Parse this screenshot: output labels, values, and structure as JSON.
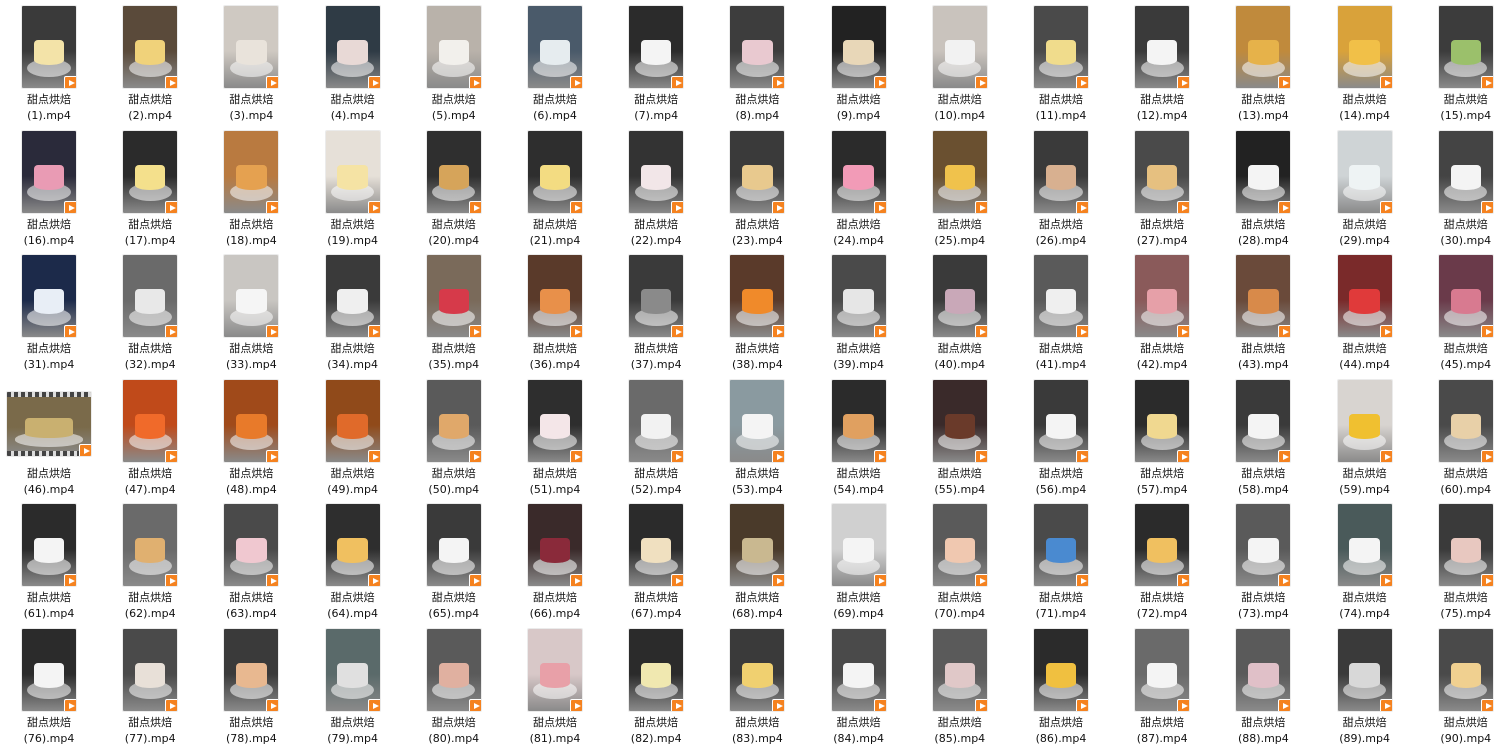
{
  "window": {
    "title": ""
  },
  "files": [
    {
      "prefix": "甜点烘焙",
      "suffix": "(1).mp4",
      "bg": "#3a3a3a",
      "accent": "#f3e3a8"
    },
    {
      "prefix": "甜点烘焙",
      "suffix": "(2).mp4",
      "bg": "#5a4a3a",
      "accent": "#f0d27a"
    },
    {
      "prefix": "甜点烘焙",
      "suffix": "(3).mp4",
      "bg": "#cfc9c2",
      "accent": "#e9e3db"
    },
    {
      "prefix": "甜点烘焙",
      "suffix": "(4).mp4",
      "bg": "#2f3b45",
      "accent": "#e8d9d6"
    },
    {
      "prefix": "甜点烘焙",
      "suffix": "(5).mp4",
      "bg": "#b9b2aa",
      "accent": "#f2f0ec"
    },
    {
      "prefix": "甜点烘焙",
      "suffix": "(6).mp4",
      "bg": "#4a5a6a",
      "accent": "#e6ecef"
    },
    {
      "prefix": "甜点烘焙",
      "suffix": "(7).mp4",
      "bg": "#2b2b2b",
      "accent": "#f4f4f4"
    },
    {
      "prefix": "甜点烘焙",
      "suffix": "(8).mp4",
      "bg": "#3d3d3d",
      "accent": "#e9c9d0"
    },
    {
      "prefix": "甜点烘焙",
      "suffix": "(9).mp4",
      "bg": "#222222",
      "accent": "#e8d7b8"
    },
    {
      "prefix": "甜点烘焙",
      "suffix": "(10).mp4",
      "bg": "#c9c3bd",
      "accent": "#f2f2f2"
    },
    {
      "prefix": "甜点烘焙",
      "suffix": "(11).mp4",
      "bg": "#4a4a4a",
      "accent": "#f0dc8c"
    },
    {
      "prefix": "甜点烘焙",
      "suffix": "(12).mp4",
      "bg": "#3a3a3a",
      "accent": "#f4f4f4"
    },
    {
      "prefix": "甜点烘焙",
      "suffix": "(13).mp4",
      "bg": "#c08a3c",
      "accent": "#e6b24a"
    },
    {
      "prefix": "甜点烘焙",
      "suffix": "(14).mp4",
      "bg": "#d9a23a",
      "accent": "#f1c048"
    },
    {
      "prefix": "甜点烘焙",
      "suffix": "(15).mp4",
      "bg": "#3c3c3c",
      "accent": "#9bc06b"
    },
    {
      "prefix": "甜点烘焙",
      "suffix": "(16).mp4",
      "bg": "#2a2a3a",
      "accent": "#e99bb4"
    },
    {
      "prefix": "甜点烘焙",
      "suffix": "(17).mp4",
      "bg": "#2b2b2b",
      "accent": "#f4e08c"
    },
    {
      "prefix": "甜点烘焙",
      "suffix": "(18).mp4",
      "bg": "#b97a40",
      "accent": "#e5a150"
    },
    {
      "prefix": "甜点烘焙",
      "suffix": "(19).mp4",
      "bg": "#e6e0d8",
      "accent": "#f5e3a4"
    },
    {
      "prefix": "甜点烘焙",
      "suffix": "(20).mp4",
      "bg": "#2f2f2f",
      "accent": "#d6a45a"
    },
    {
      "prefix": "甜点烘焙",
      "suffix": "(21).mp4",
      "bg": "#2e2e2e",
      "accent": "#f3dc82"
    },
    {
      "prefix": "甜点烘焙",
      "suffix": "(22).mp4",
      "bg": "#333333",
      "accent": "#f2e6e8"
    },
    {
      "prefix": "甜点烘焙",
      "suffix": "(23).mp4",
      "bg": "#3a3a3a",
      "accent": "#e8c98e"
    },
    {
      "prefix": "甜点烘焙",
      "suffix": "(24).mp4",
      "bg": "#2b2b2b",
      "accent": "#f29bb7"
    },
    {
      "prefix": "甜点烘焙",
      "suffix": "(25).mp4",
      "bg": "#6a5030",
      "accent": "#f0c24c"
    },
    {
      "prefix": "甜点烘焙",
      "suffix": "(26).mp4",
      "bg": "#3a3a3a",
      "accent": "#d8b090"
    },
    {
      "prefix": "甜点烘焙",
      "suffix": "(27).mp4",
      "bg": "#4a4a4a",
      "accent": "#e6c080"
    },
    {
      "prefix": "甜点烘焙",
      "suffix": "(28).mp4",
      "bg": "#222222",
      "accent": "#f4f4f4"
    },
    {
      "prefix": "甜点烘焙",
      "suffix": "(29).mp4",
      "bg": "#cfd4d6",
      "accent": "#eef3f4"
    },
    {
      "prefix": "甜点烘焙",
      "suffix": "(30).mp4",
      "bg": "#444444",
      "accent": "#f4f4f4"
    },
    {
      "prefix": "甜点烘焙",
      "suffix": "(31).mp4",
      "bg": "#1c2a4a",
      "accent": "#e8eef6"
    },
    {
      "prefix": "甜点烘焙",
      "suffix": "(32).mp4",
      "bg": "#6a6a6a",
      "accent": "#e8e8e8"
    },
    {
      "prefix": "甜点烘焙",
      "suffix": "(33).mp4",
      "bg": "#c9c6c2",
      "accent": "#f5f5f5"
    },
    {
      "prefix": "甜点烘焙",
      "suffix": "(34).mp4",
      "bg": "#3a3a3a",
      "accent": "#efefef"
    },
    {
      "prefix": "甜点烘焙",
      "suffix": "(35).mp4",
      "bg": "#7a6a5a",
      "accent": "#d63a4a"
    },
    {
      "prefix": "甜点烘焙",
      "suffix": "(36).mp4",
      "bg": "#5a3a2a",
      "accent": "#e8904a"
    },
    {
      "prefix": "甜点烘焙",
      "suffix": "(37).mp4",
      "bg": "#3a3a3a",
      "accent": "#8a8a8a"
    },
    {
      "prefix": "甜点烘焙",
      "suffix": "(38).mp4",
      "bg": "#5a3a2a",
      "accent": "#f08a2a"
    },
    {
      "prefix": "甜点烘焙",
      "suffix": "(39).mp4",
      "bg": "#4a4a4a",
      "accent": "#e6e6e6"
    },
    {
      "prefix": "甜点烘焙",
      "suffix": "(40).mp4",
      "bg": "#3a3a3a",
      "accent": "#c9a8b8"
    },
    {
      "prefix": "甜点烘焙",
      "suffix": "(41).mp4",
      "bg": "#5a5a5a",
      "accent": "#efefef"
    },
    {
      "prefix": "甜点烘焙",
      "suffix": "(42).mp4",
      "bg": "#8a5a5a",
      "accent": "#e6a0a8"
    },
    {
      "prefix": "甜点烘焙",
      "suffix": "(43).mp4",
      "bg": "#6a4a3a",
      "accent": "#d88a4a"
    },
    {
      "prefix": "甜点烘焙",
      "suffix": "(44).mp4",
      "bg": "#7a2a2a",
      "accent": "#e03a3a"
    },
    {
      "prefix": "甜点烘焙",
      "suffix": "(45).mp4",
      "bg": "#6a3a4a",
      "accent": "#d87a90"
    },
    {
      "prefix": "甜点烘焙",
      "suffix": "(46).mp4",
      "bg": "#7a6a4a",
      "accent": "#c9b070",
      "wide": true
    },
    {
      "prefix": "甜点烘焙",
      "suffix": "(47).mp4",
      "bg": "#c04a1a",
      "accent": "#f06a2a"
    },
    {
      "prefix": "甜点烘焙",
      "suffix": "(48).mp4",
      "bg": "#a04a1a",
      "accent": "#e87a2a"
    },
    {
      "prefix": "甜点烘焙",
      "suffix": "(49).mp4",
      "bg": "#904a1a",
      "accent": "#e06a2a"
    },
    {
      "prefix": "甜点烘焙",
      "suffix": "(50).mp4",
      "bg": "#5a5a5a",
      "accent": "#e0a86a"
    },
    {
      "prefix": "甜点烘焙",
      "suffix": "(51).mp4",
      "bg": "#2e2e2e",
      "accent": "#f4e6e8"
    },
    {
      "prefix": "甜点烘焙",
      "suffix": "(52).mp4",
      "bg": "#6a6a6a",
      "accent": "#f2f2f2"
    },
    {
      "prefix": "甜点烘焙",
      "suffix": "(53).mp4",
      "bg": "#8a9aa0",
      "accent": "#f4f4f4"
    },
    {
      "prefix": "甜点烘焙",
      "suffix": "(54).mp4",
      "bg": "#2b2b2b",
      "accent": "#e0a060"
    },
    {
      "prefix": "甜点烘焙",
      "suffix": "(55).mp4",
      "bg": "#3a2a2a",
      "accent": "#6a3a2a"
    },
    {
      "prefix": "甜点烘焙",
      "suffix": "(56).mp4",
      "bg": "#3a3a3a",
      "accent": "#f4f4f4"
    },
    {
      "prefix": "甜点烘焙",
      "suffix": "(57).mp4",
      "bg": "#2b2b2b",
      "accent": "#f0d890"
    },
    {
      "prefix": "甜点烘焙",
      "suffix": "(58).mp4",
      "bg": "#3a3a3a",
      "accent": "#f4f4f4"
    },
    {
      "prefix": "甜点烘焙",
      "suffix": "(59).mp4",
      "bg": "#d8d4d0",
      "accent": "#f0c030"
    },
    {
      "prefix": "甜点烘焙",
      "suffix": "(60).mp4",
      "bg": "#4a4a4a",
      "accent": "#e8d0a8"
    },
    {
      "prefix": "甜点烘焙",
      "suffix": "(61).mp4",
      "bg": "#2b2b2b",
      "accent": "#f4f4f4"
    },
    {
      "prefix": "甜点烘焙",
      "suffix": "(62).mp4",
      "bg": "#6a6a6a",
      "accent": "#e0b070"
    },
    {
      "prefix": "甜点烘焙",
      "suffix": "(63).mp4",
      "bg": "#4a4a4a",
      "accent": "#f0c8d0"
    },
    {
      "prefix": "甜点烘焙",
      "suffix": "(64).mp4",
      "bg": "#2e2e2e",
      "accent": "#f0c060"
    },
    {
      "prefix": "甜点烘焙",
      "suffix": "(65).mp4",
      "bg": "#3a3a3a",
      "accent": "#f4f4f4"
    },
    {
      "prefix": "甜点烘焙",
      "suffix": "(66).mp4",
      "bg": "#3a2a2a",
      "accent": "#8a2a3a"
    },
    {
      "prefix": "甜点烘焙",
      "suffix": "(67).mp4",
      "bg": "#2b2b2b",
      "accent": "#f0e0c0"
    },
    {
      "prefix": "甜点烘焙",
      "suffix": "(68).mp4",
      "bg": "#4a3a2a",
      "accent": "#c9b890"
    },
    {
      "prefix": "甜点烘焙",
      "suffix": "(69).mp4",
      "bg": "#d0d0d0",
      "accent": "#f4f4f4"
    },
    {
      "prefix": "甜点烘焙",
      "suffix": "(70).mp4",
      "bg": "#5a5a5a",
      "accent": "#f0c8b0"
    },
    {
      "prefix": "甜点烘焙",
      "suffix": "(71).mp4",
      "bg": "#4a4a4a",
      "accent": "#4a8ad0"
    },
    {
      "prefix": "甜点烘焙",
      "suffix": "(72).mp4",
      "bg": "#2b2b2b",
      "accent": "#f0c060"
    },
    {
      "prefix": "甜点烘焙",
      "suffix": "(73).mp4",
      "bg": "#5a5a5a",
      "accent": "#f4f4f4"
    },
    {
      "prefix": "甜点烘焙",
      "suffix": "(74).mp4",
      "bg": "#4a5a5a",
      "accent": "#f4f4f4"
    },
    {
      "prefix": "甜点烘焙",
      "suffix": "(75).mp4",
      "bg": "#3a3a3a",
      "accent": "#e8c8c0"
    },
    {
      "prefix": "甜点烘焙",
      "suffix": "(76).mp4",
      "bg": "#2b2b2b",
      "accent": "#f4f4f4"
    },
    {
      "prefix": "甜点烘焙",
      "suffix": "(77).mp4",
      "bg": "#4a4a4a",
      "accent": "#e8e0d8"
    },
    {
      "prefix": "甜点烘焙",
      "suffix": "(78).mp4",
      "bg": "#3a3a3a",
      "accent": "#e8b890"
    },
    {
      "prefix": "甜点烘焙",
      "suffix": "(79).mp4",
      "bg": "#5a6a6a",
      "accent": "#e0e0e0"
    },
    {
      "prefix": "甜点烘焙",
      "suffix": "(80).mp4",
      "bg": "#5a5a5a",
      "accent": "#e0b0a0"
    },
    {
      "prefix": "甜点烘焙",
      "suffix": "(81).mp4",
      "bg": "#d8c8c8",
      "accent": "#e8a0a8"
    },
    {
      "prefix": "甜点烘焙",
      "suffix": "(82).mp4",
      "bg": "#2b2b2b",
      "accent": "#f0e8b0"
    },
    {
      "prefix": "甜点烘焙",
      "suffix": "(83).mp4",
      "bg": "#3a3a3a",
      "accent": "#f0d070"
    },
    {
      "prefix": "甜点烘焙",
      "suffix": "(84).mp4",
      "bg": "#4a4a4a",
      "accent": "#f4f4f4"
    },
    {
      "prefix": "甜点烘焙",
      "suffix": "(85).mp4",
      "bg": "#5a5a5a",
      "accent": "#e0c8c8"
    },
    {
      "prefix": "甜点烘焙",
      "suffix": "(86).mp4",
      "bg": "#2b2b2b",
      "accent": "#f0c040"
    },
    {
      "prefix": "甜点烘焙",
      "suffix": "(87).mp4",
      "bg": "#6a6a6a",
      "accent": "#f4f4f4"
    },
    {
      "prefix": "甜点烘焙",
      "suffix": "(88).mp4",
      "bg": "#5a5a5a",
      "accent": "#e0c0c8"
    },
    {
      "prefix": "甜点烘焙",
      "suffix": "(89).mp4",
      "bg": "#3a3a3a",
      "accent": "#d8d8d8"
    },
    {
      "prefix": "甜点烘焙",
      "suffix": "(90).mp4",
      "bg": "#4a4a4a",
      "accent": "#f0d090"
    }
  ]
}
